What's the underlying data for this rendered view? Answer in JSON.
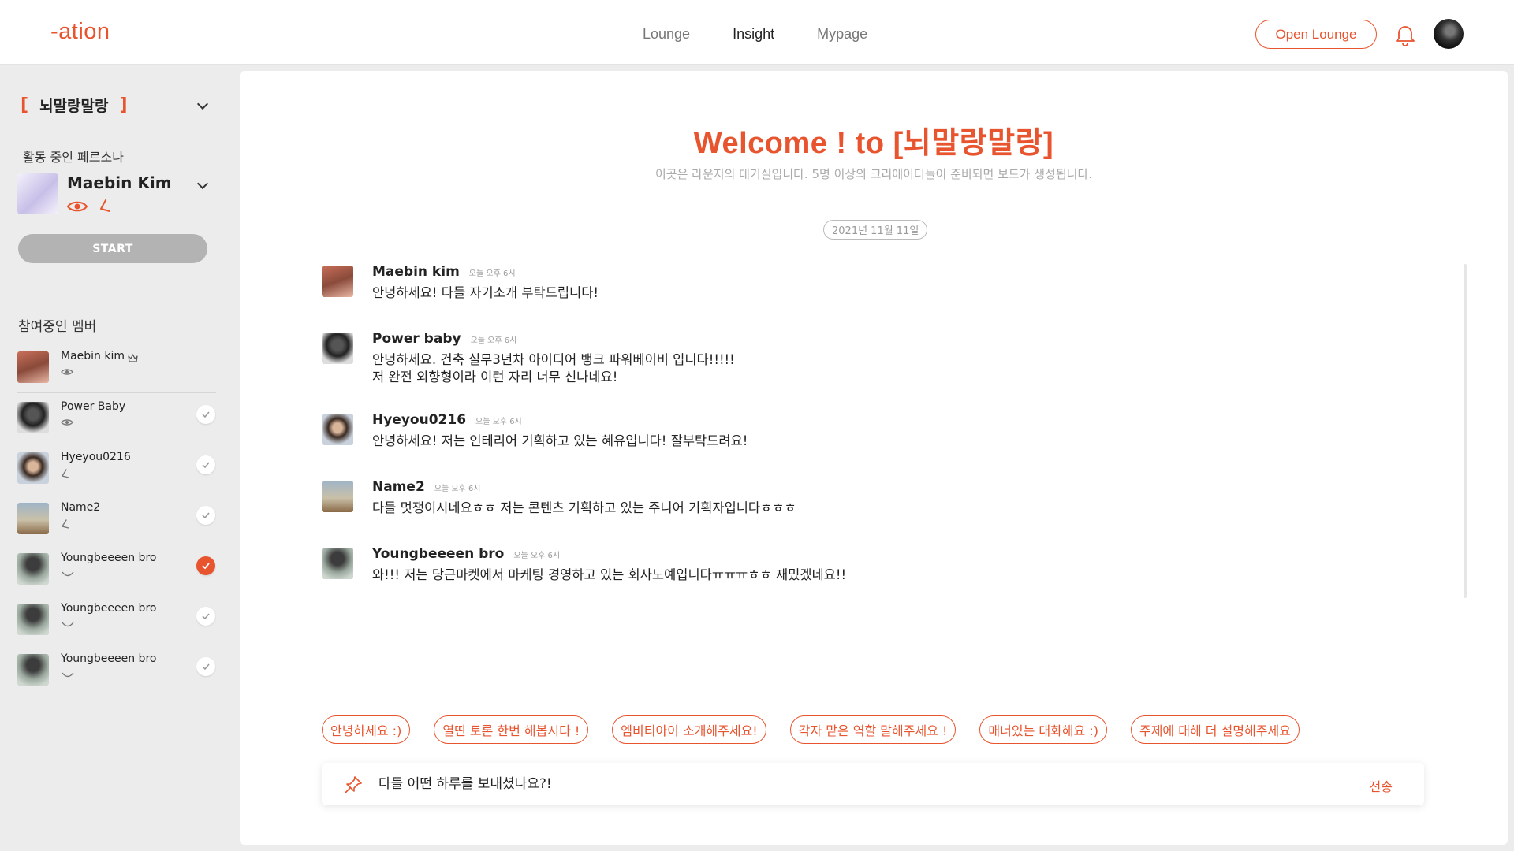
{
  "header": {
    "logo": "-ation",
    "nav": [
      "Lounge",
      "Insight",
      "Mypage"
    ],
    "active_nav": "Insight",
    "open_lounge_label": "Open Lounge"
  },
  "sidebar": {
    "room_name": "뇌말랑말랑",
    "persona_label": "활동 중인 페르소나",
    "persona_name": "Maebin Kim",
    "start_label": "START",
    "members_label": "참여중인 멤버",
    "members": [
      {
        "name": "Maebin kim",
        "role_icon": "eye-icon",
        "crown": true,
        "checked": null
      },
      {
        "name": "Power Baby",
        "role_icon": "eye-icon",
        "checked": false
      },
      {
        "name": "Hyeyou0216",
        "role_icon": "lightning-icon",
        "checked": false
      },
      {
        "name": "Name2",
        "role_icon": "lightning-icon",
        "checked": false
      },
      {
        "name": "Youngbeeeen bro",
        "role_icon": "smile-icon",
        "checked": true
      },
      {
        "name": "Youngbeeeen bro",
        "role_icon": "smile-icon",
        "checked": false
      },
      {
        "name": "Youngbeeeen bro",
        "role_icon": "smile-icon",
        "checked": false
      }
    ]
  },
  "main": {
    "welcome": "Welcome ! to [뇌말랑말랑]",
    "subtitle": "이곳은 라운지의 대기실입니다. 5명 이상의 크리에이터들이 준비되면 보드가 생성됩니다.",
    "date": "2021년 11월 11일",
    "messages": [
      {
        "author": "Maebin kim",
        "time": "오늘 오후 6시",
        "lines": [
          "안녕하세요! 다들 자기소개 부탁드립니다!"
        ]
      },
      {
        "author": "Power baby",
        "time": "오늘 오후 6시",
        "lines": [
          "안녕하세요. 건축 실무3년차 아이디어 뱅크 파워베이비 입니다!!!!!",
          "저 완전 외향형이라 이런 자리 너무 신나네요!"
        ]
      },
      {
        "author": "Hyeyou0216",
        "time": "오늘 오후 6시",
        "lines": [
          "안녕하세요! 저는 인테리어 기획하고 있는 혜유입니다! 잘부탁드려요!"
        ]
      },
      {
        "author": "Name2",
        "time": "오늘 오후 6시",
        "lines": [
          "다들 멋쟁이시네요ㅎㅎ 저는 콘텐츠 기획하고 있는 주니어 기획자입니다ㅎㅎㅎ"
        ]
      },
      {
        "author": "Youngbeeeen bro",
        "time": "오늘 오후 6시",
        "lines": [
          "와!!! 저는 당근마켓에서 마케팅 경영하고 있는 회사노예입니다ㅠㅠㅠㅎㅎ 재밌겠네요!!"
        ]
      }
    ],
    "chips": [
      "안녕하세요 :)",
      "열띤 토론 한번 해봅시다 !",
      "엠비티아이 소개해주세요!",
      "각자 맡은 역할 말해주세요 !",
      "매너있는 대화해요 :)",
      "주제에 대해 더 설명해주세요"
    ],
    "input_value": "다들 어떤 하루를 보내셨나요?!",
    "send_label": "전송"
  },
  "colors": {
    "accent": "#e8542e",
    "sidebar_bg": "#ececec",
    "start_btn": "#b3b3b3"
  }
}
